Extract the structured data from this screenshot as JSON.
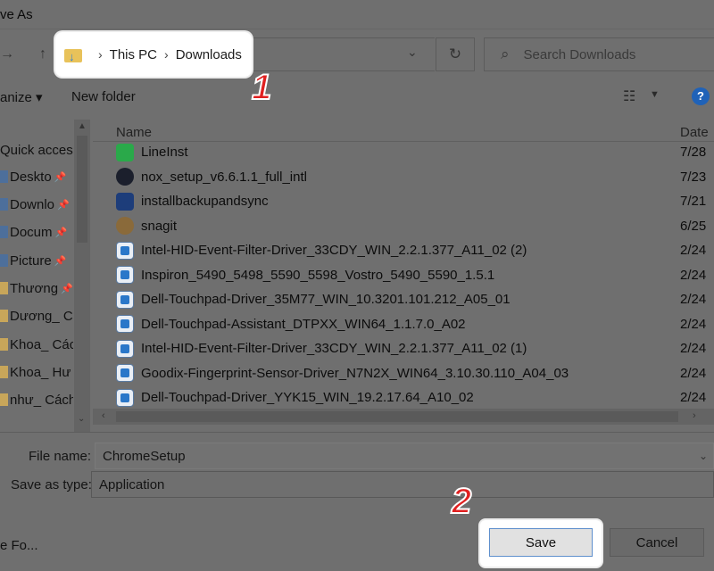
{
  "window": {
    "title": "ve As"
  },
  "address": {
    "crumbs": [
      "This PC",
      "Downloads"
    ],
    "separator": "›"
  },
  "search": {
    "placeholder": "Search Downloads"
  },
  "steps": {
    "one": "1",
    "two": "2"
  },
  "toolbar": {
    "organize": "anize ▾",
    "new_folder": "New folder",
    "help": "?"
  },
  "nav": {
    "items": [
      {
        "label": "Quick acces",
        "pinned": false,
        "icon": "star-icon"
      },
      {
        "label": "Deskto",
        "pinned": true,
        "icon": "desktop-icon"
      },
      {
        "label": "Downlo",
        "pinned": true,
        "icon": "download-icon"
      },
      {
        "label": "Docum",
        "pinned": true,
        "icon": "document-icon"
      },
      {
        "label": "Picture",
        "pinned": true,
        "icon": "picture-icon"
      },
      {
        "label": "Thương",
        "pinned": true,
        "icon": "folder-icon"
      },
      {
        "label": "Dương_ C",
        "pinned": false,
        "icon": "folder-icon"
      },
      {
        "label": "Khoa_ Các",
        "pinned": false,
        "icon": "folder-icon"
      },
      {
        "label": "Khoa_ Hư",
        "pinned": false,
        "icon": "folder-icon"
      },
      {
        "label": "như_ Cách",
        "pinned": false,
        "icon": "folder-icon"
      }
    ]
  },
  "list": {
    "col_name": "Name",
    "col_date": "Date",
    "rows": [
      {
        "name": "LineInst",
        "date": "7/28",
        "icon": "line"
      },
      {
        "name": "nox_setup_v6.6.1.1_full_intl",
        "date": "7/23",
        "icon": "nox"
      },
      {
        "name": "installbackupandsync",
        "date": "7/21",
        "icon": "install"
      },
      {
        "name": "snagit",
        "date": "6/25",
        "icon": "snag"
      },
      {
        "name": "Intel-HID-Event-Filter-Driver_33CDY_WIN_2.2.1.377_A11_02 (2)",
        "date": "2/24",
        "icon": "setup"
      },
      {
        "name": "Inspiron_5490_5498_5590_5598_Vostro_5490_5590_1.5.1",
        "date": "2/24",
        "icon": "setup"
      },
      {
        "name": "Dell-Touchpad-Driver_35M77_WIN_10.3201.101.212_A05_01",
        "date": "2/24",
        "icon": "setup"
      },
      {
        "name": "Dell-Touchpad-Assistant_DTPXX_WIN64_1.1.7.0_A02",
        "date": "2/24",
        "icon": "setup"
      },
      {
        "name": "Intel-HID-Event-Filter-Driver_33CDY_WIN_2.2.1.377_A11_02 (1)",
        "date": "2/24",
        "icon": "setup"
      },
      {
        "name": "Goodix-Fingerprint-Sensor-Driver_N7N2X_WIN64_3.10.30.110_A04_03",
        "date": "2/24",
        "icon": "setup"
      },
      {
        "name": "Dell-Touchpad-Driver_YYK15_WIN_19.2.17.64_A10_02",
        "date": "2/24",
        "icon": "setup"
      }
    ]
  },
  "form": {
    "filename_label": "File name:",
    "filename_value": "ChromeSetup",
    "type_label": "Save as type:",
    "type_value": "Application"
  },
  "footer": {
    "hide_folders": "e Fo...",
    "save": "Save",
    "cancel": "Cancel"
  }
}
